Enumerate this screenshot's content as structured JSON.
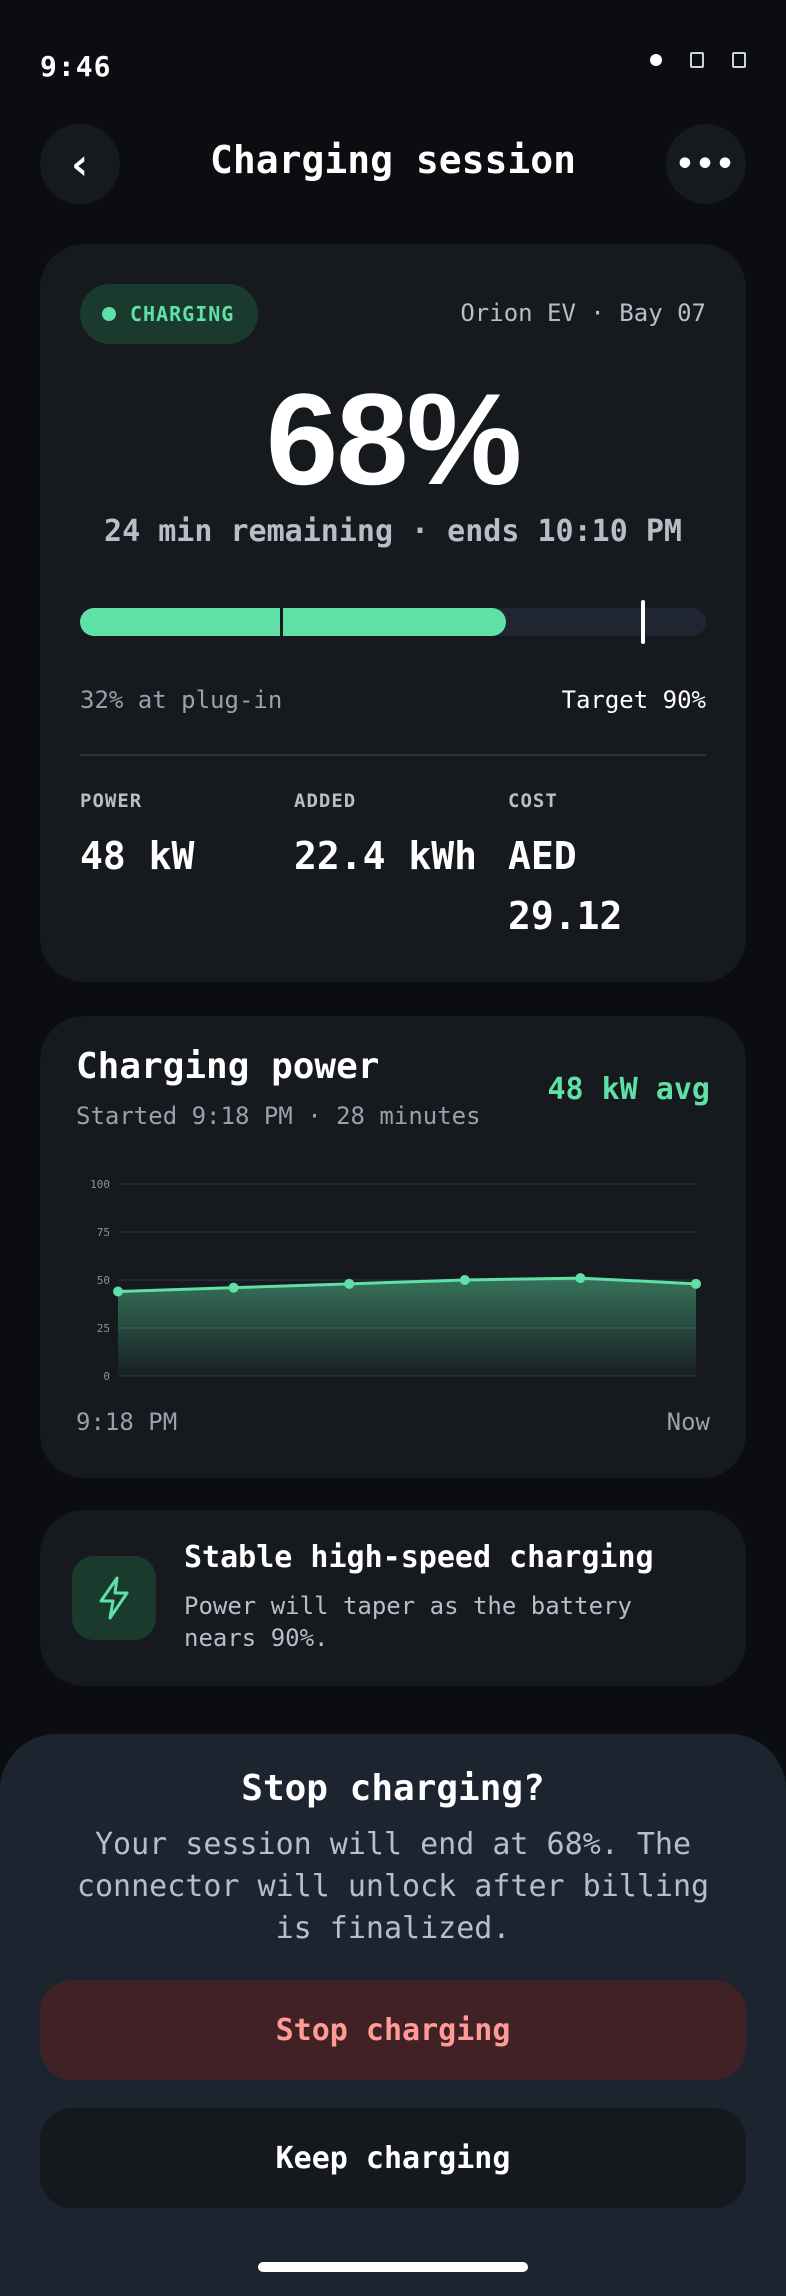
{
  "status_bar": {
    "time": "9:46",
    "icons": [
      "signal-dot-icon",
      "wifi-icon",
      "battery-icon"
    ]
  },
  "header": {
    "title": "Charging session",
    "back_icon": "‹",
    "more_icon": "•••"
  },
  "session": {
    "status": "CHARGING",
    "vehicle": "Orion EV · Bay 07",
    "percent": "68%",
    "remaining": "24 min remaining · ends 10:10 PM",
    "progress": {
      "current": 0.68,
      "plugin": 0.32,
      "target": 0.9
    },
    "plugin_label": "32% at plug-in",
    "target_label": "Target 90%",
    "stats": [
      {
        "label": "POWER",
        "value": "48 kW"
      },
      {
        "label": "ADDED",
        "value": "22.4 kWh"
      },
      {
        "label": "COST",
        "value": "AED 29.12"
      }
    ]
  },
  "power_chart": {
    "title": "Charging power",
    "subtitle": "Started 9:18 PM · 28 minutes",
    "avg_label": "48 kW avg",
    "x_start": "9:18 PM",
    "x_end": "Now"
  },
  "chart_data": {
    "type": "area",
    "title": "Charging power",
    "xlabel": "",
    "ylabel": "",
    "ylim": [
      0,
      100
    ],
    "yticks": [
      "100",
      "75",
      "50",
      "25",
      "0"
    ],
    "x": [
      "9:18 PM",
      "",
      "",
      "",
      "",
      "Now"
    ],
    "values": [
      44,
      46,
      48,
      50,
      51,
      48
    ],
    "grid": true,
    "color": "#5ee0a6"
  },
  "tip": {
    "icon": "bolt-icon",
    "title": "Stable high-speed charging",
    "text": "Power will taper as the battery nears 90%."
  },
  "sheet": {
    "title": "Stop charging?",
    "text": "Your session will end at 68%. The connector will unlock after billing is finalized.",
    "stop_label": "Stop charging",
    "keep_label": "Keep charging"
  },
  "colors": {
    "accent": "#5ee0a6",
    "danger": "#ff9b94",
    "background": "#0b0d10",
    "card": "#16191e"
  }
}
